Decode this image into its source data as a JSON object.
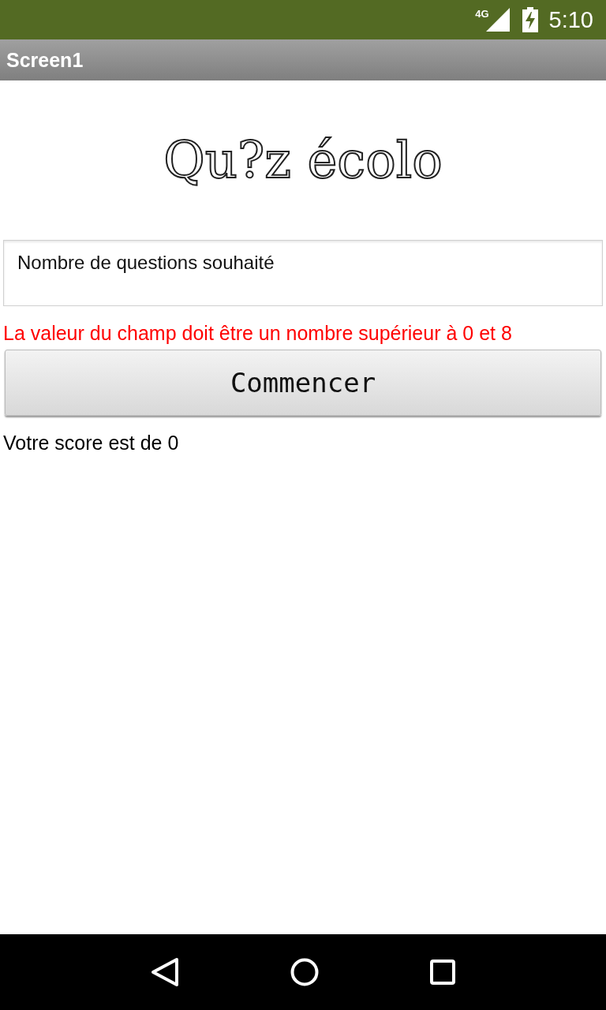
{
  "status_bar": {
    "network": "4G",
    "time": "5:10"
  },
  "title_bar": {
    "title": "Screen1"
  },
  "logo": {
    "text": "Qu?z écolo"
  },
  "questions_field": {
    "value": "Nombre de questions souhaité"
  },
  "error_message": "La valeur du champ doit être un nombre supérieur à 0 et 8",
  "start_button": {
    "label": "Commencer"
  },
  "score_text": "Votre score est de 0"
}
